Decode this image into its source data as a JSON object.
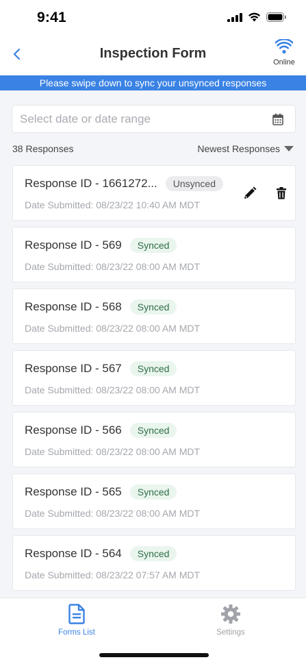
{
  "status_bar": {
    "time": "9:41"
  },
  "header": {
    "title": "Inspection Form",
    "connection_label": "Online"
  },
  "banner": {
    "text": "Please swipe down to sync your unsynced responses"
  },
  "date_filter": {
    "placeholder": "Select date or date range",
    "value": ""
  },
  "list_meta": {
    "count_label": "38 Responses",
    "sort_label": "Newest Responses"
  },
  "responses": [
    {
      "title": "Response ID - 1661272...",
      "status": "Unsynced",
      "date": "Date Submitted: 08/23/22 10:40 AM MDT"
    },
    {
      "title": "Response ID - 569",
      "status": "Synced",
      "date": "Date Submitted: 08/23/22 08:00 AM MDT"
    },
    {
      "title": "Response ID - 568",
      "status": "Synced",
      "date": "Date Submitted: 08/23/22 08:00 AM MDT"
    },
    {
      "title": "Response ID - 567",
      "status": "Synced",
      "date": "Date Submitted: 08/23/22 08:00 AM MDT"
    },
    {
      "title": "Response ID - 566",
      "status": "Synced",
      "date": "Date Submitted: 08/23/22 08:00 AM MDT"
    },
    {
      "title": "Response ID - 565",
      "status": "Synced",
      "date": "Date Submitted: 08/23/22 08:00 AM MDT"
    },
    {
      "title": "Response ID - 564",
      "status": "Synced",
      "date": "Date Submitted: 08/23/22 07:57 AM MDT"
    }
  ],
  "tabs": [
    {
      "label": "Forms List",
      "icon": "document-icon",
      "active": true
    },
    {
      "label": "Settings",
      "icon": "gear-icon",
      "active": false
    }
  ],
  "colors": {
    "accent": "#3a82e4",
    "synced_text": "#2e6e46",
    "synced_bg": "#eaf5ee",
    "unsynced_bg": "#ececee"
  }
}
